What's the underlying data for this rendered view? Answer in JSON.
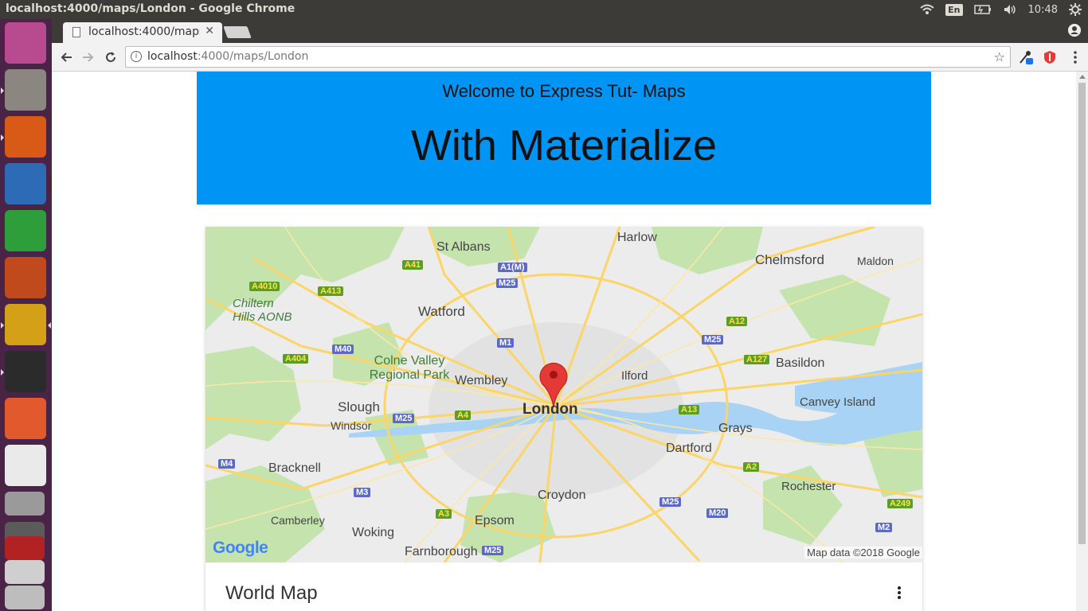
{
  "os": {
    "window_title": "localhost:4000/maps/London - Google Chrome",
    "keyboard_layout": "En",
    "clock": "10:48"
  },
  "browser": {
    "tab_title": "localhost:4000/maps/London",
    "url_host": "localhost",
    "url_rest": ":4000/maps/London"
  },
  "page": {
    "hero_subtitle": "Welcome to Express Tut- Maps",
    "hero_title": "With Materialize",
    "card_title": "World Map",
    "map_attribution": "Map data ©2018 Google",
    "map_logo": "Google"
  },
  "map": {
    "places": [
      {
        "name": "St Albans",
        "size": 16,
        "bold": false
      },
      {
        "name": "Harlow",
        "size": 16,
        "bold": false
      },
      {
        "name": "Chelmsford",
        "size": 17,
        "bold": false
      },
      {
        "name": "Maldon",
        "size": 14,
        "bold": false
      },
      {
        "name": "Watford",
        "size": 17,
        "bold": false
      },
      {
        "name": "Chiltern Hills AONB",
        "size": 15,
        "bold": false
      },
      {
        "name": "Colne Valley Regional Park",
        "size": 16,
        "bold": false
      },
      {
        "name": "Wembley",
        "size": 16,
        "bold": false
      },
      {
        "name": "Ilford",
        "size": 15,
        "bold": false
      },
      {
        "name": "Basildon",
        "size": 16,
        "bold": false
      },
      {
        "name": "Canvey Island",
        "size": 15,
        "bold": false
      },
      {
        "name": "Slough",
        "size": 17,
        "bold": false
      },
      {
        "name": "Windsor",
        "size": 14,
        "bold": false
      },
      {
        "name": "London",
        "size": 19,
        "bold": true
      },
      {
        "name": "Grays",
        "size": 16,
        "bold": false
      },
      {
        "name": "Dartford",
        "size": 16,
        "bold": false
      },
      {
        "name": "Bracknell",
        "size": 16,
        "bold": false
      },
      {
        "name": "Rochester",
        "size": 15,
        "bold": false
      },
      {
        "name": "Croydon",
        "size": 16,
        "bold": false
      },
      {
        "name": "Camberley",
        "size": 14,
        "bold": false
      },
      {
        "name": "Woking",
        "size": 16,
        "bold": false
      },
      {
        "name": "Epsom",
        "size": 16,
        "bold": false
      },
      {
        "name": "Farnborough",
        "size": 16,
        "bold": false
      }
    ],
    "roads": [
      {
        "name": "A41",
        "kind": "g"
      },
      {
        "name": "A1(M)",
        "kind": "m"
      },
      {
        "name": "M25",
        "kind": "m"
      },
      {
        "name": "A4010",
        "kind": "g"
      },
      {
        "name": "A413",
        "kind": "g"
      },
      {
        "name": "A12",
        "kind": "g"
      },
      {
        "name": "M40",
        "kind": "m"
      },
      {
        "name": "M1",
        "kind": "m"
      },
      {
        "name": "M25",
        "kind": "m"
      },
      {
        "name": "A404",
        "kind": "g"
      },
      {
        "name": "A127",
        "kind": "g"
      },
      {
        "name": "M25",
        "kind": "m"
      },
      {
        "name": "A4",
        "kind": "g"
      },
      {
        "name": "A13",
        "kind": "g"
      },
      {
        "name": "M4",
        "kind": "m"
      },
      {
        "name": "A2",
        "kind": "g"
      },
      {
        "name": "M3",
        "kind": "m"
      },
      {
        "name": "M25",
        "kind": "m"
      },
      {
        "name": "A249",
        "kind": "g"
      },
      {
        "name": "A3",
        "kind": "g"
      },
      {
        "name": "M20",
        "kind": "m"
      },
      {
        "name": "M2",
        "kind": "m"
      },
      {
        "name": "M25",
        "kind": "m"
      }
    ],
    "colors": {
      "land": "#ececec",
      "green": "#bfe0a8",
      "water": "#a9d3f5",
      "road_major": "#fcd86b",
      "pin": "#e53935"
    }
  },
  "launcher": {
    "apps": [
      {
        "icon": "ubuntu-dash-icon",
        "color": "#b84a8f"
      },
      {
        "icon": "files-icon",
        "color": "#8b8680"
      },
      {
        "icon": "firefox-icon",
        "color": "#d95a17"
      },
      {
        "icon": "writer-icon",
        "color": "#2e6bb7"
      },
      {
        "icon": "calc-icon",
        "color": "#2e9e3a"
      },
      {
        "icon": "impress-icon",
        "color": "#c04a1b"
      },
      {
        "icon": "chrome-icon",
        "color": "#d4a017"
      },
      {
        "icon": "terminal-icon",
        "color": "#2b2b2b"
      },
      {
        "icon": "software-center-icon",
        "color": "#e2592d"
      },
      {
        "icon": "amazon-icon",
        "color": "#eaeaea"
      },
      {
        "icon": "settings-icon",
        "color": "#9a9a9a"
      },
      {
        "icon": "sublime-icon",
        "color": "#5b5b5b"
      },
      {
        "icon": "filezilla-icon",
        "color": "#b22222"
      },
      {
        "icon": "workspace-switcher-icon",
        "color": "#cfcfcf"
      },
      {
        "icon": "trash-icon",
        "color": "#bdbdbd"
      }
    ]
  }
}
